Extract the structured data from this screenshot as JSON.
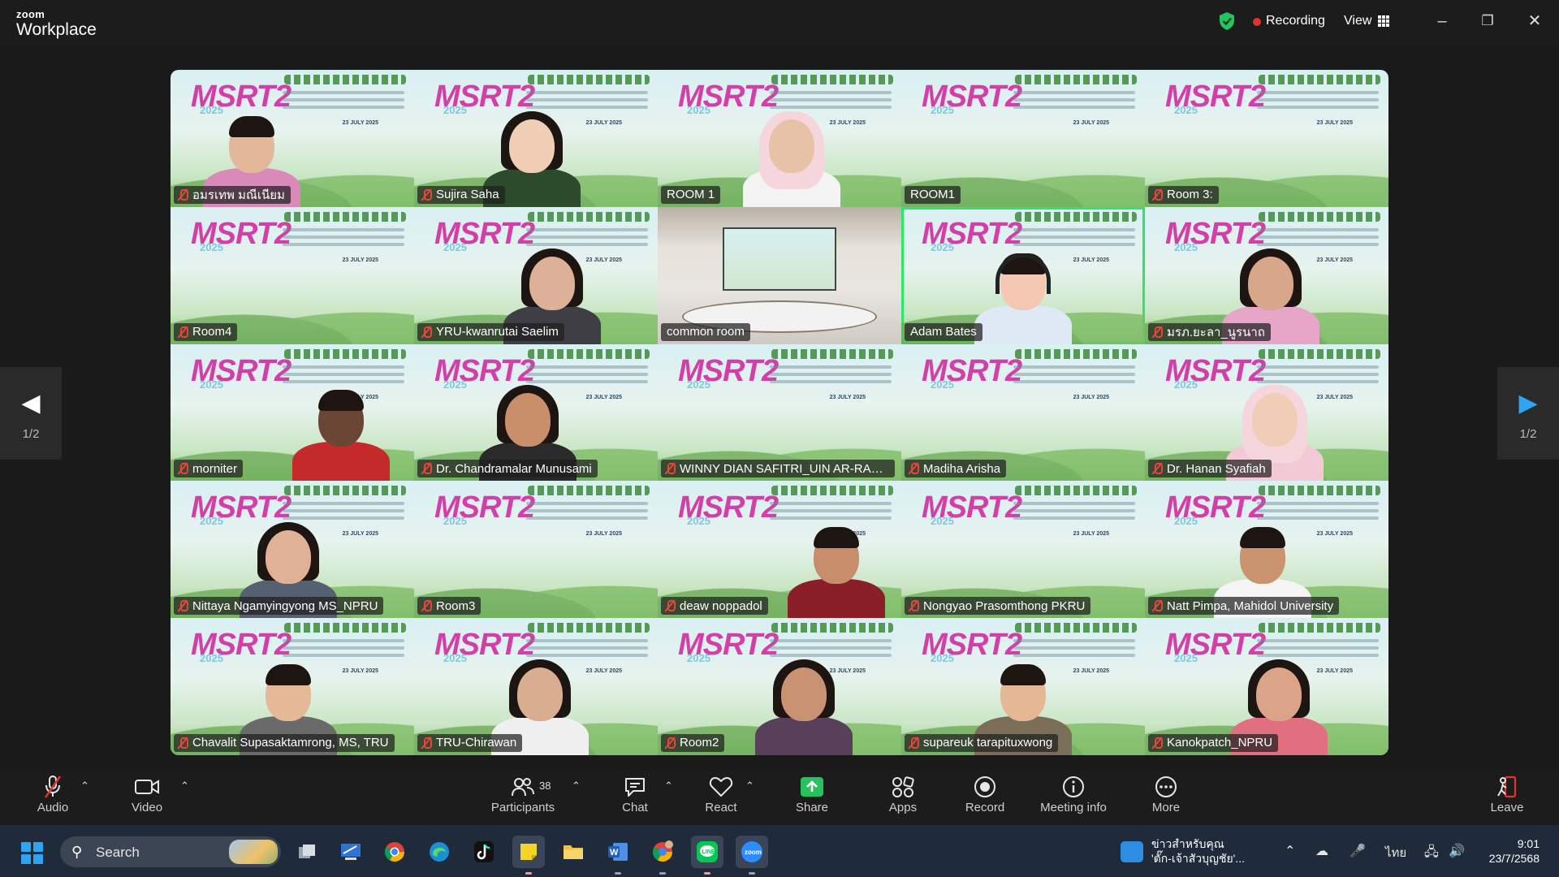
{
  "app": {
    "brand_small": "zoom",
    "brand_big": "Workplace"
  },
  "titlebar": {
    "recording_label": "Recording",
    "view_label": "View",
    "recording_color": "#e5322d",
    "secure_color": "#22c55e"
  },
  "gallery": {
    "banner_logo": "MSRT2",
    "banner_year": "2025",
    "banner_date": "23 JULY 2025",
    "participants": [
      {
        "name": "อมรเทพ มณีเนียม",
        "muted": true
      },
      {
        "name": "Sujira Saha",
        "muted": true
      },
      {
        "name": "ROOM 1",
        "muted": false
      },
      {
        "name": "ROOM1",
        "muted": false
      },
      {
        "name": "Room 3:",
        "muted": true
      },
      {
        "name": "Room4",
        "muted": true
      },
      {
        "name": "YRU-kwanrutai Saelim",
        "muted": true
      },
      {
        "name": "common room",
        "muted": false
      },
      {
        "name": "Adam Bates",
        "muted": false,
        "active_speaker": true
      },
      {
        "name": "มรภ.ยะลา_นูรนาถ",
        "muted": true
      },
      {
        "name": "morniter",
        "muted": true
      },
      {
        "name": "Dr. Chandramalar Munusami",
        "muted": true
      },
      {
        "name": "WINNY DIAN SAFITRI_UIN AR-RANI...",
        "muted": true
      },
      {
        "name": "Madiha Arisha",
        "muted": true
      },
      {
        "name": "Dr. Hanan Syafiah",
        "muted": true
      },
      {
        "name": "Nittaya Ngamyingyong MS_NPRU",
        "muted": true
      },
      {
        "name": "Room3",
        "muted": true
      },
      {
        "name": "deaw noppadol",
        "muted": true
      },
      {
        "name": "Nongyao Prasomthong PKRU",
        "muted": true
      },
      {
        "name": "Natt Pimpa, Mahidol University",
        "muted": true
      },
      {
        "name": "Chavalit Supasaktamrong, MS, TRU",
        "muted": true
      },
      {
        "name": "TRU-Chirawan",
        "muted": true
      },
      {
        "name": "Room2",
        "muted": true
      },
      {
        "name": "supareuk tarapituxwong",
        "muted": true
      },
      {
        "name": "Kanokpatch_NPRU",
        "muted": true
      }
    ],
    "pager_left": "1/2",
    "pager_right": "1/2",
    "active_border_color": "#2ee56a"
  },
  "toolbar": {
    "audio": "Audio",
    "video": "Video",
    "participants": "Participants",
    "participants_count": "38",
    "chat": "Chat",
    "react": "React",
    "share": "Share",
    "apps": "Apps",
    "record": "Record",
    "meeting_info": "Meeting info",
    "more": "More",
    "leave": "Leave",
    "share_color": "#27c25f",
    "leave_color": "#e5322d"
  },
  "taskbar": {
    "search_label": "Search",
    "news_line1": "ข่าวสำหรับคุณ",
    "news_line2": "'ตั๊ก-เจ้าสัวบุญชัย'...",
    "language": "ไทย",
    "time": "9:01",
    "date": "23/7/2568"
  }
}
